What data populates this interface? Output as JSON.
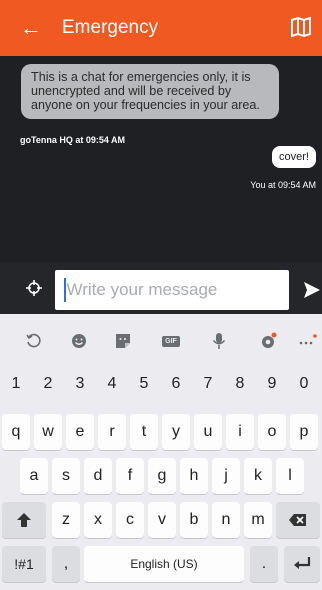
{
  "header": {
    "title": "Emergency",
    "back_icon": "arrow-left-icon",
    "map_icon": "map-icon",
    "accent": "#f05a22"
  },
  "messages": [
    {
      "direction": "incoming",
      "text": "This is a chat for emergencies only, it is unencrypted and will be received by anyone on your frequencies in your area.",
      "sender": "goTenna HQ at 09:54 AM"
    },
    {
      "direction": "outgoing",
      "text": "cover!",
      "sender": "You at 09:54 AM"
    }
  ],
  "composer": {
    "placeholder": "Write your message",
    "location_icon": "crosshair-icon",
    "send_icon": "send-icon"
  },
  "keyboard": {
    "tools": [
      "rotate-icon",
      "emoji-icon",
      "sticker-icon",
      "GIF",
      "mic-icon",
      "settings-icon",
      "more-icon"
    ],
    "numbers": [
      "1",
      "2",
      "3",
      "4",
      "5",
      "6",
      "7",
      "8",
      "9",
      "0"
    ],
    "row1": [
      "q",
      "w",
      "e",
      "r",
      "t",
      "y",
      "u",
      "i",
      "o",
      "p"
    ],
    "row2": [
      "a",
      "s",
      "d",
      "f",
      "g",
      "h",
      "j",
      "k",
      "l"
    ],
    "row3": [
      "z",
      "x",
      "c",
      "v",
      "b",
      "n",
      "m"
    ],
    "symbols_key": "!#1",
    "comma_key": ",",
    "space_label": "English (US)",
    "period_key": "."
  }
}
